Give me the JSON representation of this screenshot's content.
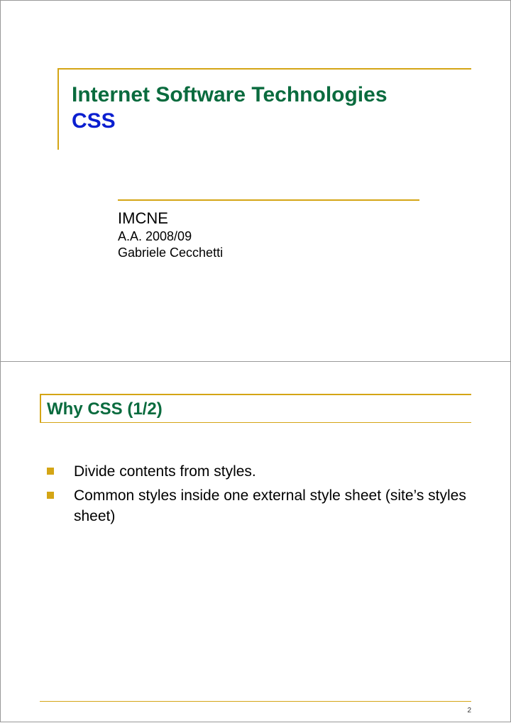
{
  "slide1": {
    "title_main": "Internet Software Technologies",
    "title_sub": "CSS",
    "org": "IMCNE",
    "year": "A.A. 2008/09",
    "author": "Gabriele Cecchetti"
  },
  "slide2": {
    "heading": "Why CSS (1/2)",
    "bullets": [
      "Divide contents from styles.",
      "Common styles inside one external style sheet (site’s styles sheet)"
    ],
    "page_number": "2"
  }
}
